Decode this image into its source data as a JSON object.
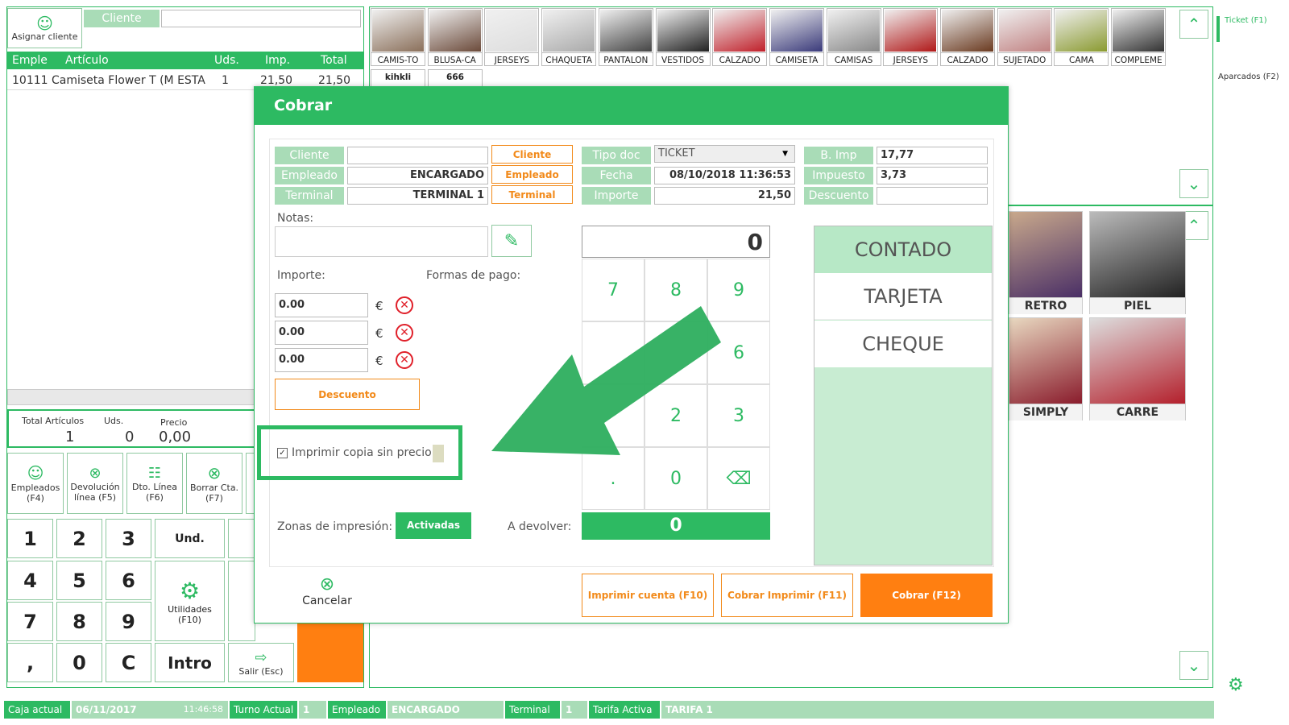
{
  "customer": {
    "assign_label": "Asignar cliente",
    "client_label": "Cliente",
    "client_value": ""
  },
  "ticket": {
    "columns": [
      "Emple",
      "Artículo",
      "Uds.",
      "Imp.",
      "Total"
    ],
    "rows": [
      {
        "emp": "10111",
        "article": "Camiseta Flower T (M ESTA",
        "uds": "1",
        "imp": "21,50",
        "total": "21,50"
      }
    ]
  },
  "totals": {
    "label_articles": "Total Artículos",
    "articles": "1",
    "label_uds": "Uds.",
    "uds": "0",
    "label_price": "Precio",
    "price": "0,00"
  },
  "funcs": [
    {
      "label": "Empleados (F4)"
    },
    {
      "label": "Devolución línea (F5)"
    },
    {
      "label": "Dto. Línea (F6)"
    },
    {
      "label": "Borrar Cta. (F7)"
    }
  ],
  "keys": {
    "k1": "1",
    "k2": "2",
    "k3": "3",
    "und": "Und.",
    "k4": "4",
    "k5": "5",
    "k6": "6",
    "util": "Utilidades (F10)",
    "k7": "7",
    "k8": "8",
    "k9": "9",
    "comma": ",",
    "k0": "0",
    "c": "C",
    "intro": "Intro",
    "exit": "Salir (Esc)"
  },
  "categories": [
    "CAMIS-TO",
    "BLUSA-CA",
    "JERSEYS",
    "CHAQUETA",
    "PANTALON",
    "VESTIDOS",
    "CALZADO",
    "CAMISETA",
    "CAMISAS",
    "JERSEYS",
    "CALZADO",
    "SUJETADO",
    "CAMA",
    "COMPLEME"
  ],
  "categories2": [
    "kihkli",
    "666"
  ],
  "right_nav": {
    "ticket": "Ticket (F1)",
    "aparcados": "Aparcados (F2)"
  },
  "products": [
    "RETRO",
    "PIEL",
    "SIMPLY",
    "CARRE"
  ],
  "dialog": {
    "title": "Cobrar",
    "labels": {
      "cliente": "Cliente",
      "empleado": "Empleado",
      "terminal": "Terminal",
      "tipo_doc": "Tipo doc",
      "fecha": "Fecha",
      "importe": "Importe",
      "b_imp": "B. Imp",
      "impuesto": "Impuesto",
      "descuento": "Descuento"
    },
    "values": {
      "cliente": "",
      "empleado": "ENCARGADO",
      "terminal": "TERMINAL 1",
      "tipo_doc": "TICKET",
      "fecha": "08/10/2018 11:36:53",
      "importe": "21,50",
      "b_imp": "17,77",
      "impuesto": "3,73",
      "descuento": ""
    },
    "btn_cliente": "Cliente",
    "btn_empleado": "Empleado",
    "btn_terminal": "Terminal",
    "notes_label": "Notas:",
    "importe_label": "Importe:",
    "formas_label": "Formas de pago:",
    "amounts": [
      "0.00",
      "0.00",
      "0.00"
    ],
    "currency": "€",
    "discount_btn": "Descuento",
    "print_copy": "Imprimir copia sin precio",
    "zones_label": "Zonas de impresión:",
    "zones_btn": "Activadas",
    "devolver_label": "A devolver:",
    "devolver_value": "0",
    "display": "0",
    "pad": [
      "7",
      "8",
      "9",
      "6",
      "2",
      "3",
      ".",
      "0"
    ],
    "payments": [
      "CONTADO",
      "TARJETA",
      "CHEQUE"
    ],
    "cancel": "Cancelar",
    "print_account": "Imprimir cuenta (F10)",
    "charge_print": "Cobrar Imprimir (F11)",
    "charge": "Cobrar (F12)"
  },
  "status": {
    "caja_label": "Caja actual",
    "caja_date": "06/11/2017",
    "caja_time": "11:46:58",
    "turno_label": "Turno Actual",
    "turno": "1",
    "empleado_label": "Empleado",
    "empleado": "ENCARGADO",
    "terminal_label": "Terminal",
    "terminal": "1",
    "tarifa_label": "Tarifa Activa",
    "tarifa": "TARIFA 1"
  },
  "colors": {
    "green": "#2dba62",
    "light_green": "#a9dcb7",
    "orange": "#ff7f11"
  }
}
